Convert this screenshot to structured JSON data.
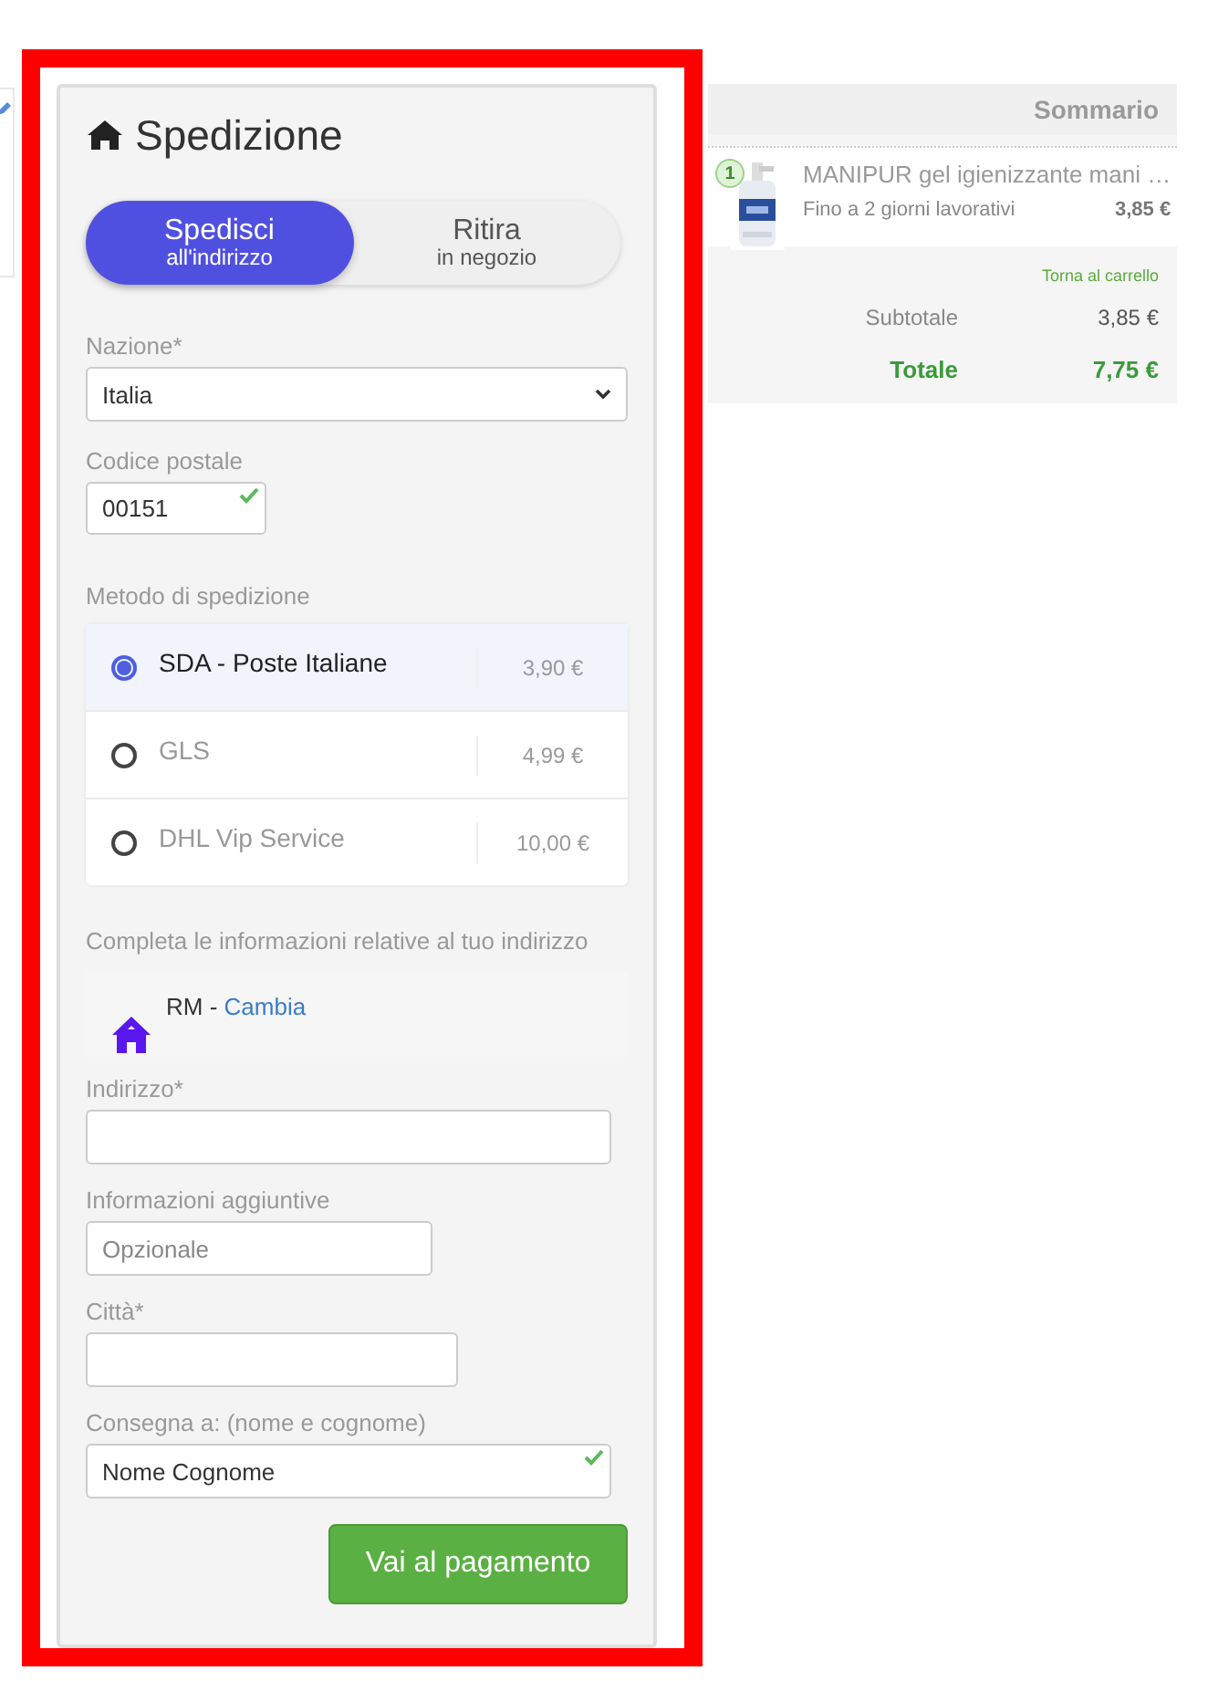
{
  "shipping": {
    "title": "Spedizione",
    "modes": [
      {
        "label": "Spedisci",
        "sublabel": "all'indirizzo",
        "selected": true
      },
      {
        "label": "Ritira",
        "sublabel": "in negozio",
        "selected": false
      }
    ],
    "country": {
      "label": "Nazione*",
      "value": "Italia"
    },
    "postal_code": {
      "label": "Codice postale",
      "value": "00151",
      "valid": true
    },
    "method_label": "Metodo di spedizione",
    "methods": [
      {
        "name": "SDA - Poste Italiane",
        "price": "3,90 €",
        "selected": true
      },
      {
        "name": "GLS",
        "price": "4,99 €",
        "selected": false
      },
      {
        "name": "DHL Vip Service",
        "price": "10,00 €",
        "selected": false
      }
    ],
    "address_intro": "Completa le informazioni relative al tuo indirizzo",
    "province": {
      "text": "RM -",
      "link": "Cambia"
    },
    "fields": [
      {
        "label": "Indirizzo*",
        "valid": false
      },
      {
        "label": "Informazioni aggiuntive",
        "placeholder": "Opzionale",
        "valid": false
      },
      {
        "label": "Città*",
        "valid": false
      },
      {
        "label": "Consegna a: (nome e cognome)",
        "value": "Nome Cognome",
        "valid": true
      }
    ],
    "submit": "Vai al pagamento"
  },
  "summary": {
    "title": "Sommario",
    "items": [
      {
        "quantity": "1",
        "name": "MANIPUR gel igienizzante mani …",
        "delivery": "Fino a 2 giorni lavorativi",
        "price": "3,85 €"
      }
    ],
    "back_link": "Torna al carrello",
    "subtotal": {
      "label": "Subtotale",
      "value": "3,85 €"
    },
    "total": {
      "label": "Totale",
      "value": "7,75 €"
    }
  }
}
